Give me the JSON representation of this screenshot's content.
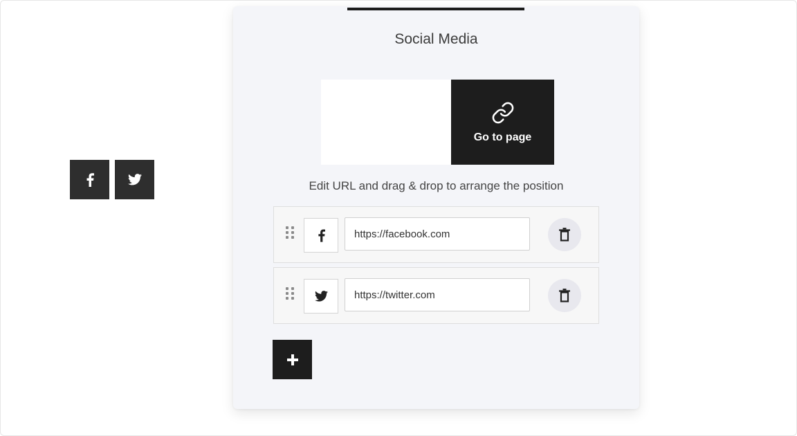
{
  "canvas": {
    "social_buttons": [
      {
        "icon": "facebook-icon"
      },
      {
        "icon": "twitter-icon"
      }
    ]
  },
  "panel": {
    "title": "Social Media",
    "preview": {
      "go_to_page_label": "Go to page",
      "icon": "link-icon"
    },
    "hint": "Edit URL and drag & drop to arrange the position",
    "links": [
      {
        "icon": "facebook-icon",
        "url": "https://facebook.com"
      },
      {
        "icon": "twitter-icon",
        "url": "https://twitter.com"
      }
    ],
    "add_icon": "plus-icon",
    "delete_icon": "trash-icon"
  },
  "colors": {
    "dark": "#1d1d1d",
    "panel_bg": "#f4f5f9",
    "button_dark": "#2e2e2e"
  }
}
